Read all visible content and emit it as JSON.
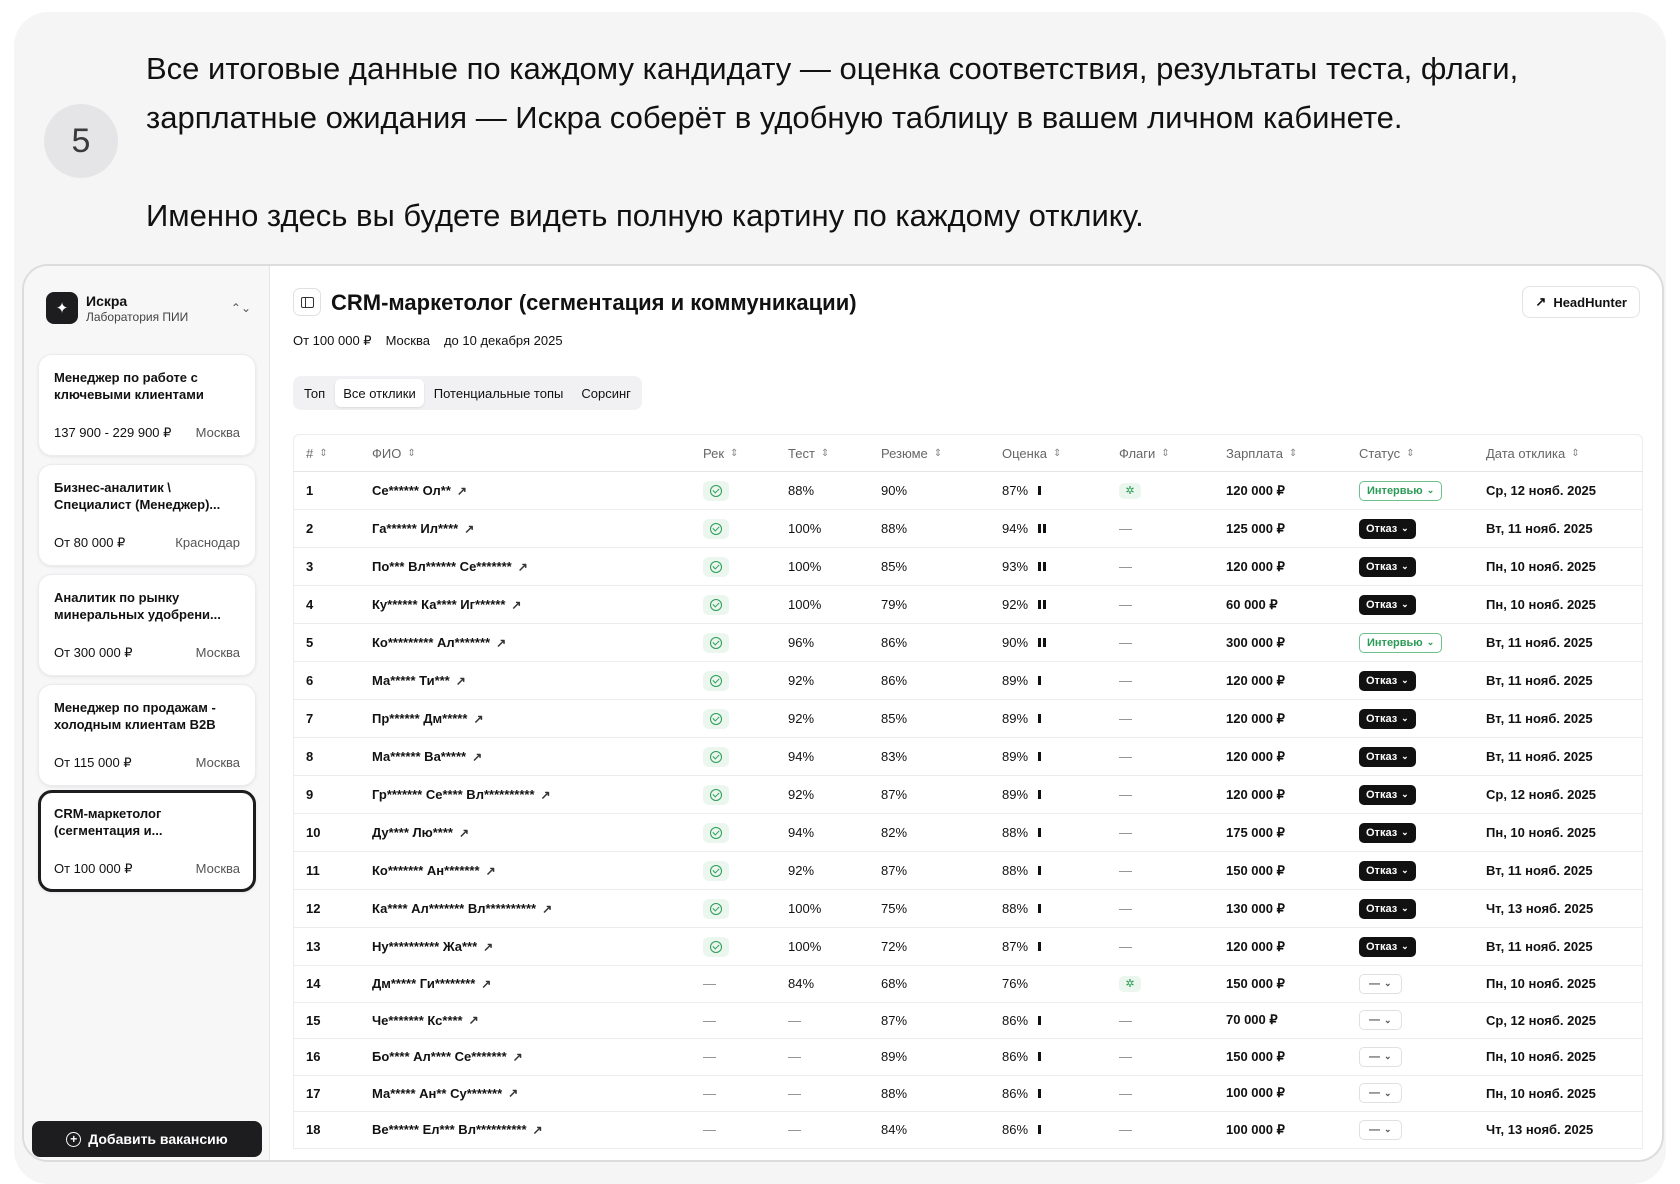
{
  "step": {
    "number": "5",
    "paragraph1": "Все итоговые данные по каждому кандидату — оценка соответствия, результаты теста, флаги, зарплатные ожидания — Искра соберёт в удобную таблицу в вашем личном кабинете.",
    "paragraph2": "Именно здесь вы будете видеть полную картину по каждому отклику."
  },
  "sidebar": {
    "org_name": "Искра",
    "org_sub": "Лаборатория ПИИ",
    "vacancies": [
      {
        "title": "Менеджер по работе с ключевыми клиентами",
        "salary": "137 900 - 229 900 ₽",
        "city": "Москва",
        "active": false
      },
      {
        "title": "Бизнес-аналитик \\ Специалист (Менеджер)...",
        "salary": "От 80 000 ₽",
        "city": "Краснодар",
        "active": false
      },
      {
        "title": "Аналитик по рынку минеральных удобрени...",
        "salary": "От 300 000 ₽",
        "city": "Москва",
        "active": false
      },
      {
        "title": "Менеджер по продажам - холодным клиентам B2B",
        "salary": "От 115 000 ₽",
        "city": "Москва",
        "active": false
      },
      {
        "title": "CRM-маркетолог (сегментация и...",
        "salary": "От 100 000 ₽",
        "city": "Москва",
        "active": true
      }
    ],
    "add_button": "Добавить вакансию"
  },
  "main": {
    "title": "CRM-маркетолог (сегментация и коммуникации)",
    "source_button": "HeadHunter",
    "meta": {
      "salary": "От 100 000 ₽",
      "city": "Москва",
      "deadline": "до 10 декабря 2025"
    },
    "tabs": [
      {
        "label": "Топ",
        "active": false
      },
      {
        "label": "Все отклики",
        "active": true
      },
      {
        "label": "Потенциальные топы",
        "active": false
      },
      {
        "label": "Сорсинг",
        "active": false
      }
    ]
  },
  "table": {
    "columns": [
      "#",
      "ФИО",
      "Рек",
      "Тест",
      "Резюме",
      "Оценка",
      "Флаги",
      "Зарплата",
      "Статус",
      "Дата отклика"
    ],
    "rows": [
      {
        "n": "1",
        "name": "Се****** Ол**",
        "rec": true,
        "test": "88%",
        "resume": "90%",
        "score": "87%",
        "bars": 1,
        "flag": true,
        "salary": "120 000 ₽",
        "status": "Интервью",
        "status_kind": "interview",
        "date": "Ср, 12 нояб. 2025"
      },
      {
        "n": "2",
        "name": "Га****** Ил****",
        "rec": true,
        "test": "100%",
        "resume": "88%",
        "score": "94%",
        "bars": 2,
        "flag": false,
        "salary": "125 000 ₽",
        "status": "Отказ",
        "status_kind": "refuse",
        "date": "Вт, 11 нояб. 2025"
      },
      {
        "n": "3",
        "name": "По*** Вл****** Се*******",
        "rec": true,
        "test": "100%",
        "resume": "85%",
        "score": "93%",
        "bars": 2,
        "flag": false,
        "salary": "120 000 ₽",
        "status": "Отказ",
        "status_kind": "refuse",
        "date": "Пн, 10 нояб. 2025"
      },
      {
        "n": "4",
        "name": "Ку****** Ка**** Иг******",
        "rec": true,
        "test": "100%",
        "resume": "79%",
        "score": "92%",
        "bars": 2,
        "flag": false,
        "salary": "60 000 ₽",
        "status": "Отказ",
        "status_kind": "refuse",
        "date": "Пн, 10 нояб. 2025"
      },
      {
        "n": "5",
        "name": "Ко********* Ал*******",
        "rec": true,
        "test": "96%",
        "resume": "86%",
        "score": "90%",
        "bars": 2,
        "flag": false,
        "salary": "300 000 ₽",
        "status": "Интервью",
        "status_kind": "interview",
        "date": "Вт, 11 нояб. 2025"
      },
      {
        "n": "6",
        "name": "Ма***** Ти***",
        "rec": true,
        "test": "92%",
        "resume": "86%",
        "score": "89%",
        "bars": 1,
        "flag": false,
        "salary": "120 000 ₽",
        "status": "Отказ",
        "status_kind": "refuse",
        "date": "Вт, 11 нояб. 2025"
      },
      {
        "n": "7",
        "name": "Пр****** Дм*****",
        "rec": true,
        "test": "92%",
        "resume": "85%",
        "score": "89%",
        "bars": 1,
        "flag": false,
        "salary": "120 000 ₽",
        "status": "Отказ",
        "status_kind": "refuse",
        "date": "Вт, 11 нояб. 2025"
      },
      {
        "n": "8",
        "name": "Ма****** Ва*****",
        "rec": true,
        "test": "94%",
        "resume": "83%",
        "score": "89%",
        "bars": 1,
        "flag": false,
        "salary": "120 000 ₽",
        "status": "Отказ",
        "status_kind": "refuse",
        "date": "Вт, 11 нояб. 2025"
      },
      {
        "n": "9",
        "name": "Гр******* Се**** Вл**********",
        "rec": true,
        "test": "92%",
        "resume": "87%",
        "score": "89%",
        "bars": 1,
        "flag": false,
        "salary": "120 000 ₽",
        "status": "Отказ",
        "status_kind": "refuse",
        "date": "Ср, 12 нояб. 2025"
      },
      {
        "n": "10",
        "name": "Ду**** Лю****",
        "rec": true,
        "test": "94%",
        "resume": "82%",
        "score": "88%",
        "bars": 1,
        "flag": false,
        "salary": "175 000 ₽",
        "status": "Отказ",
        "status_kind": "refuse",
        "date": "Пн, 10 нояб. 2025"
      },
      {
        "n": "11",
        "name": "Ко******* Ан*******",
        "rec": true,
        "test": "92%",
        "resume": "87%",
        "score": "88%",
        "bars": 1,
        "flag": false,
        "salary": "150 000 ₽",
        "status": "Отказ",
        "status_kind": "refuse",
        "date": "Вт, 11 нояб. 2025"
      },
      {
        "n": "12",
        "name": "Ка**** Ал******* Вл**********",
        "rec": true,
        "test": "100%",
        "resume": "75%",
        "score": "88%",
        "bars": 1,
        "flag": false,
        "salary": "130 000 ₽",
        "status": "Отказ",
        "status_kind": "refuse",
        "date": "Чт, 13 нояб. 2025"
      },
      {
        "n": "13",
        "name": "Ну********** Жа***",
        "rec": true,
        "test": "100%",
        "resume": "72%",
        "score": "87%",
        "bars": 1,
        "flag": false,
        "salary": "120 000 ₽",
        "status": "Отказ",
        "status_kind": "refuse",
        "date": "Вт, 11 нояб. 2025"
      },
      {
        "n": "14",
        "name": "Дм***** Ги********",
        "rec": false,
        "test": "84%",
        "resume": "68%",
        "score": "76%",
        "bars": 0,
        "flag": true,
        "salary": "150 000 ₽",
        "status": "—",
        "status_kind": "none",
        "date": "Пн, 10 нояб. 2025"
      },
      {
        "n": "15",
        "name": "Че******* Кс****",
        "rec": false,
        "test": "—",
        "resume": "87%",
        "score": "86%",
        "bars": 1,
        "flag": false,
        "salary": "70 000 ₽",
        "status": "—",
        "status_kind": "none",
        "date": "Ср, 12 нояб. 2025"
      },
      {
        "n": "16",
        "name": "Бо**** Ал**** Се*******",
        "rec": false,
        "test": "—",
        "resume": "89%",
        "score": "86%",
        "bars": 1,
        "flag": false,
        "salary": "150 000 ₽",
        "status": "—",
        "status_kind": "none",
        "date": "Пн, 10 нояб. 2025"
      },
      {
        "n": "17",
        "name": "Ма***** Ан** Су*******",
        "rec": false,
        "test": "—",
        "resume": "88%",
        "score": "86%",
        "bars": 1,
        "flag": false,
        "salary": "100 000 ₽",
        "status": "—",
        "status_kind": "none",
        "date": "Пн, 10 нояб. 2025"
      },
      {
        "n": "18",
        "name": "Ве****** Ел*** Вл**********",
        "rec": false,
        "test": "—",
        "resume": "84%",
        "score": "86%",
        "bars": 1,
        "flag": false,
        "salary": "100 000 ₽",
        "status": "—",
        "status_kind": "none",
        "date": "Чт, 13 нояб. 2025"
      }
    ],
    "empty_cell": "—"
  },
  "colors": {
    "accent_green": "#2a9c55",
    "dark": "#1d1d1f"
  }
}
